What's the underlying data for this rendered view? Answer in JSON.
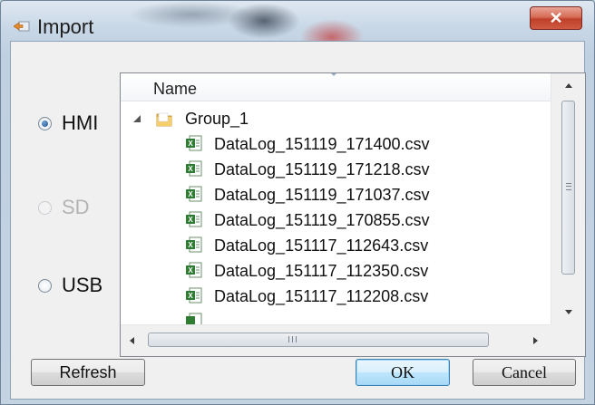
{
  "window": {
    "title": "Import",
    "close_glyph": "✕"
  },
  "sources": [
    {
      "label": "HMI",
      "selected": true,
      "enabled": true
    },
    {
      "label": "SD",
      "selected": false,
      "enabled": false
    },
    {
      "label": "USB",
      "selected": false,
      "enabled": true
    }
  ],
  "tree": {
    "column_header": "Name",
    "group": {
      "label": "Group_1",
      "expanded": true,
      "icon": "folder-icon"
    },
    "files": [
      "DataLog_151119_171400.csv",
      "DataLog_151119_171218.csv",
      "DataLog_151119_171037.csv",
      "DataLog_151119_170855.csv",
      "DataLog_151117_112643.csv",
      "DataLog_151117_112350.csv",
      "DataLog_151117_112208.csv"
    ],
    "file_icon": "excel-csv-icon",
    "hscroll_grip": "III"
  },
  "buttons": {
    "refresh": "Refresh",
    "ok": "OK",
    "cancel": "Cancel"
  },
  "colors": {
    "close_button": "#c0402a",
    "default_button_border": "#3c7fb1",
    "selected_radio": "#1f4f8a",
    "excel_green": "#2e7d32"
  }
}
